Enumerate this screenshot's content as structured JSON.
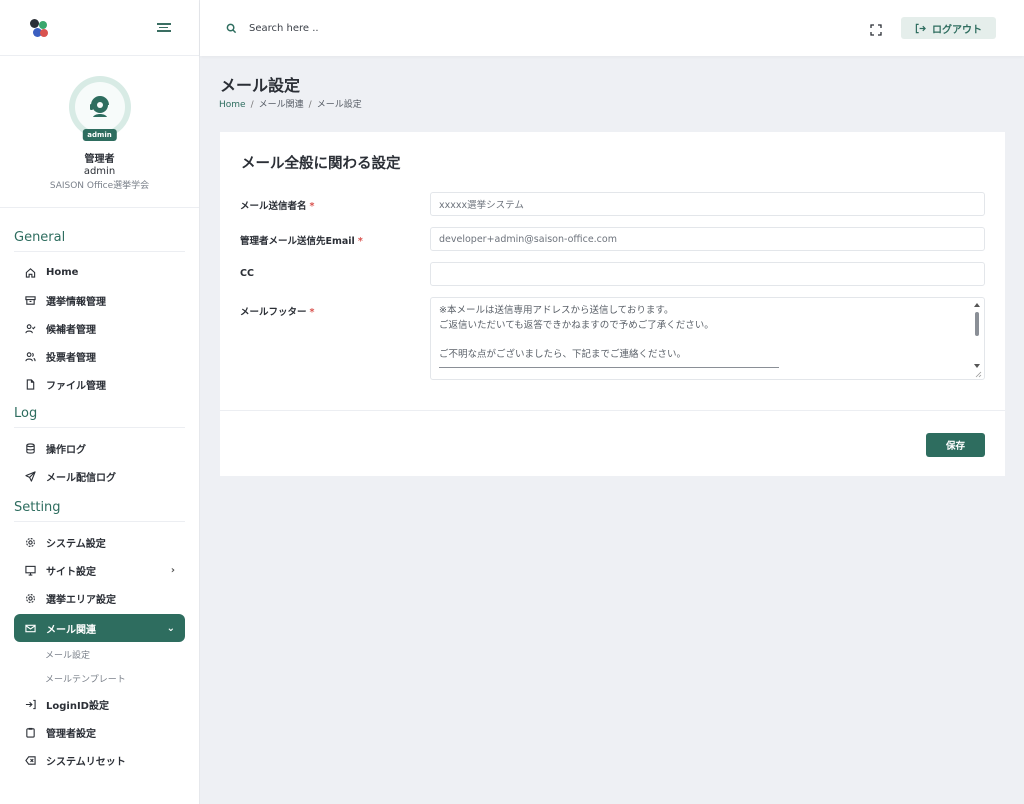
{
  "colors": {
    "accent": "#2e6d5f",
    "required": "#d9534f",
    "bg": "#eef0f4"
  },
  "sidebar": {
    "profile": {
      "badge": "admin",
      "role": "管理者",
      "username": "admin",
      "organization": "SAISON Office選挙学会"
    },
    "sections": [
      {
        "heading": "General",
        "items": [
          {
            "label": "Home",
            "icon": "home-icon"
          },
          {
            "label": "選挙情報管理",
            "icon": "archive-icon"
          },
          {
            "label": "候補者管理",
            "icon": "user-check-icon"
          },
          {
            "label": "投票者管理",
            "icon": "users-icon"
          },
          {
            "label": "ファイル管理",
            "icon": "file-icon"
          }
        ]
      },
      {
        "heading": "Log",
        "items": [
          {
            "label": "操作ログ",
            "icon": "database-icon"
          },
          {
            "label": "メール配信ログ",
            "icon": "send-icon"
          }
        ]
      },
      {
        "heading": "Setting",
        "items": [
          {
            "label": "システム設定",
            "icon": "gear-icon"
          },
          {
            "label": "サイト設定",
            "icon": "monitor-icon"
          },
          {
            "label": "選挙エリア設定",
            "icon": "gear-icon"
          },
          {
            "label": "メール関連",
            "icon": "mail-icon"
          },
          {
            "label": "LoginID設定",
            "icon": "login-icon"
          },
          {
            "label": "管理者設定",
            "icon": "clipboard-icon"
          },
          {
            "label": "システムリセット",
            "icon": "delete-icon"
          }
        ]
      }
    ],
    "mail_submenu": [
      "メール設定",
      "メールテンプレート"
    ]
  },
  "topbar": {
    "search_placeholder": "Search here ..",
    "logout_label": "ログアウト"
  },
  "page": {
    "title": "メール設定",
    "breadcrumb": [
      "Home",
      "メール関連",
      "メール設定"
    ]
  },
  "form": {
    "card_title": "メール全般に関わる設定",
    "fields": [
      {
        "label": "メール送信者名",
        "required_mark": "*",
        "value": "xxxxx選挙システム"
      },
      {
        "label": "管理者メール送信先Email",
        "required_mark": "*",
        "value": "developer+admin@saison-office.com"
      },
      {
        "label": "CC",
        "value": ""
      },
      {
        "label": "メールフッター",
        "required_mark": "*",
        "lines": [
          "※本メールは送信専用アドレスから送信しております。",
          "ご返信いただいても返答できかねますので予めご了承ください。",
          "",
          "ご不明な点がございましたら、下記までご連絡ください。"
        ]
      }
    ],
    "save_label": "保存"
  }
}
